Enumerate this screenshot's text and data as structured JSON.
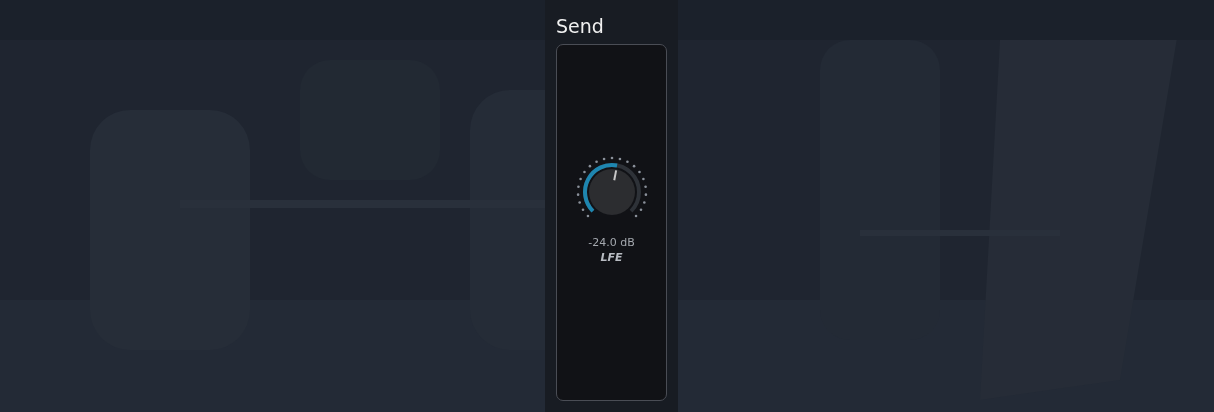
{
  "panel": {
    "title": "Send"
  },
  "knob": {
    "level": 0.54,
    "reading": "-24.0 dB",
    "label": "LFE"
  }
}
